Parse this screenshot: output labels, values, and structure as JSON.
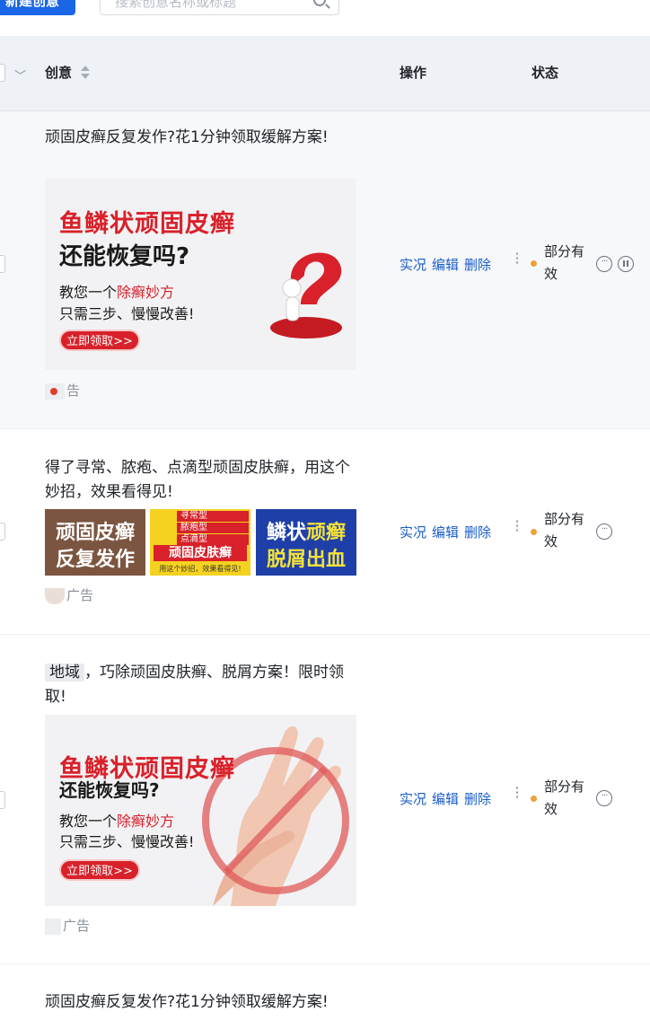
{
  "toolbar": {
    "create_button": "新建创意",
    "search_placeholder": "搜索创意名称或标题"
  },
  "table": {
    "headers": {
      "creative": "创意",
      "actions": "操作",
      "status": "状态"
    }
  },
  "rows": [
    {
      "title": "顽固皮癣反复发作?花1分钟领取缓解方案!",
      "image": {
        "headline": "鱼鳞状顽固皮癣",
        "subhead": "还能恢复吗?",
        "line1_prefix": "教您一个",
        "line1_highlight": "除癣妙方",
        "line2": "只需三步、慢慢改善!",
        "cta": "立即领取>>"
      },
      "ad_label_suffix": "告",
      "actions": [
        "实况",
        "编辑",
        "删除"
      ],
      "status": "部分有效"
    },
    {
      "title": "得了寻常、脓疱、点滴型顽固皮肤癣，用这个妙招，效果看得见!",
      "thumbs": [
        {
          "line1": "顽固皮癣",
          "line2": "反复发作"
        },
        {
          "tags": [
            "寻常型",
            "脓疱型",
            "点滴型"
          ],
          "banner": "顽固皮肤癣",
          "caption": "用这个妙招，效果看得见!"
        },
        {
          "line1_white": "鳞状",
          "line1_yellow": "顽癣",
          "line2": "脱屑出血"
        }
      ],
      "ad_label_suffix": "广告",
      "actions": [
        "实况",
        "编辑",
        "删除"
      ],
      "status": "部分有效"
    },
    {
      "title_keyword": "地域",
      "title_rest": "，巧除顽固皮肤癣、脱屑方案！限时领取!",
      "image": {
        "headline": "鱼鳞状顽固皮癣",
        "subhead": "还能恢复吗?",
        "line1_prefix": "教您一个",
        "line1_highlight": "除癣妙方",
        "line2": "只需三步、慢慢改善!",
        "cta": "立即领取>>"
      },
      "ad_label": "广告",
      "actions": [
        "实况",
        "编辑",
        "删除"
      ],
      "status": "部分有效"
    },
    {
      "title": "顽固皮癣反复发作?花1分钟领取缓解方案!"
    }
  ],
  "colors": {
    "primary": "#1a66e6",
    "link": "#1a5ec8",
    "status_dot": "#e8a33a",
    "brand_red": "#d8212a"
  }
}
